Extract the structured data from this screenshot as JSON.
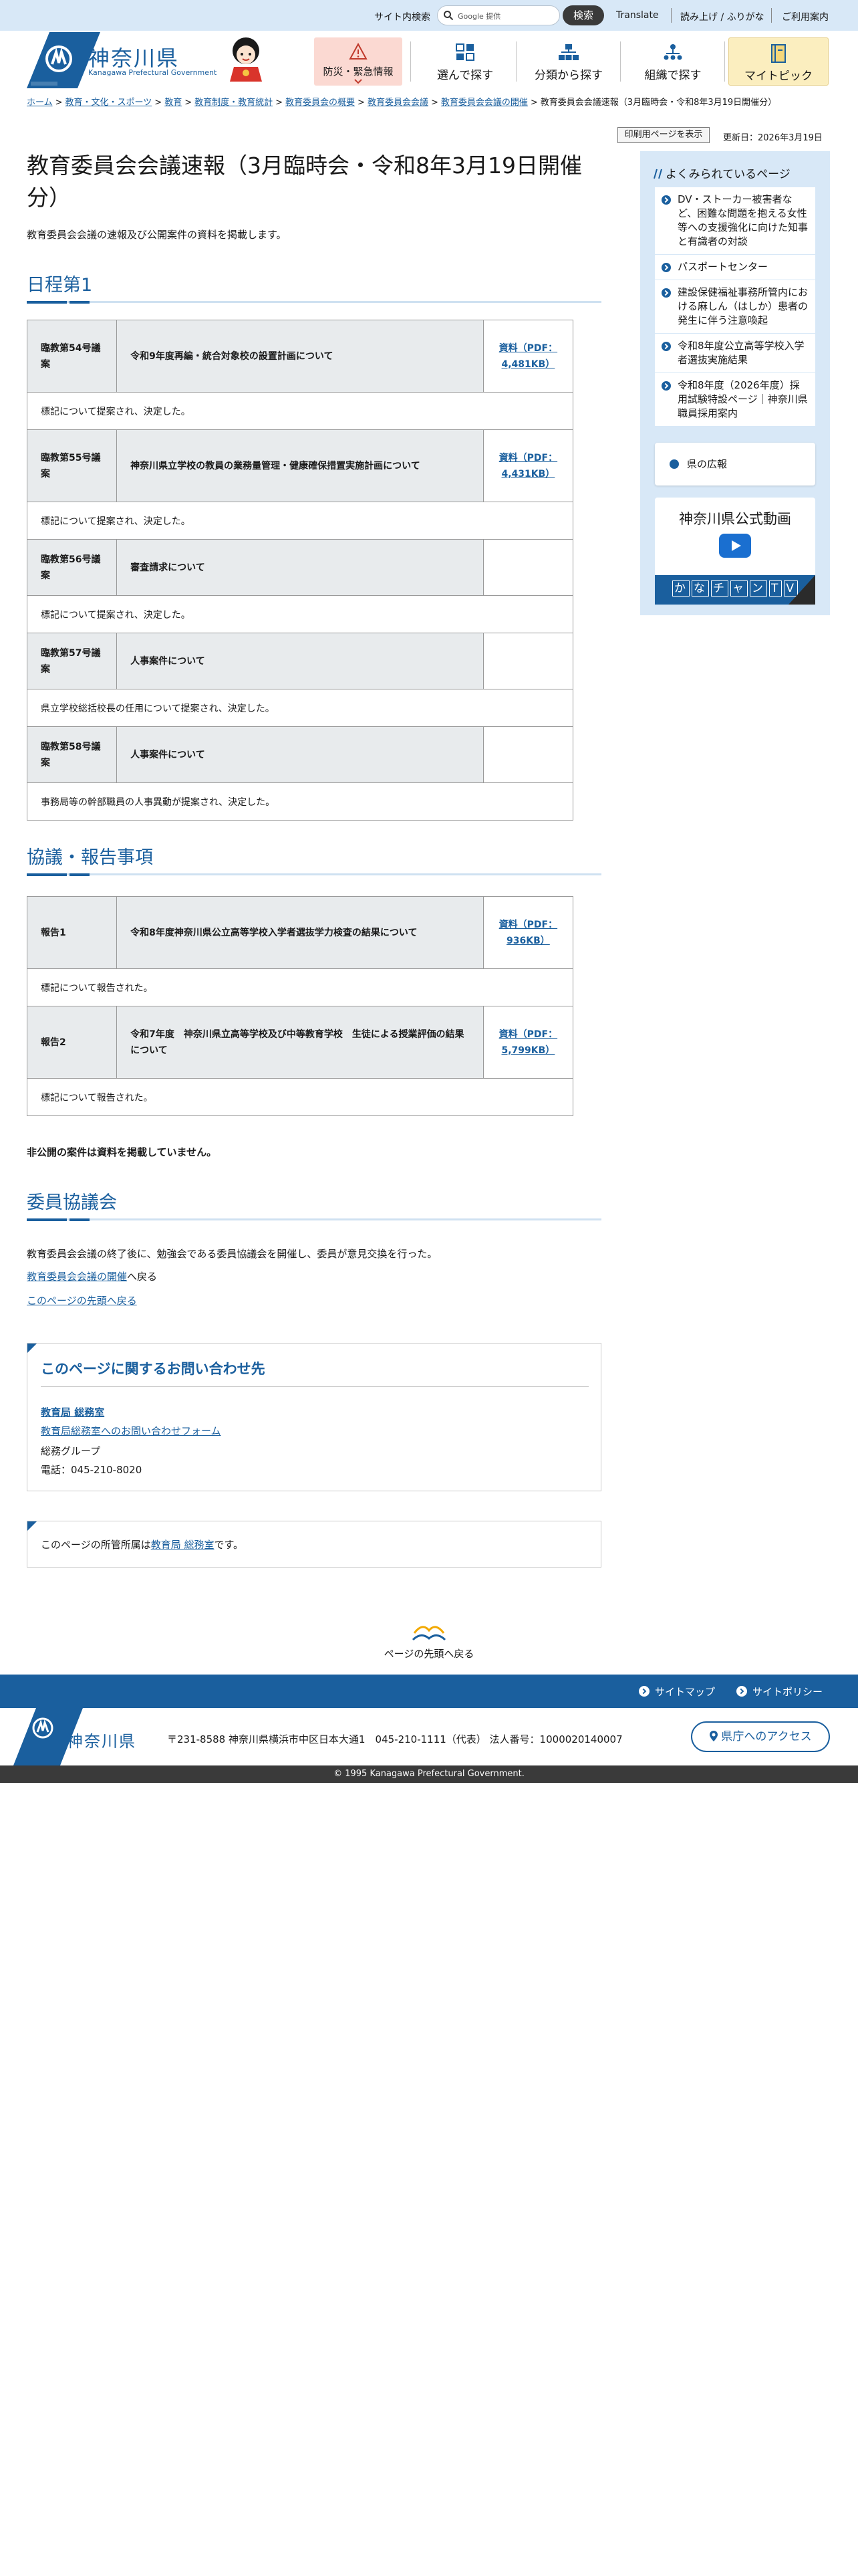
{
  "utility": {
    "search_label": "サイト内検索",
    "search_placeholder": "Google 提供",
    "search_button": "検索",
    "translate": "Translate",
    "furigana": "読み上げ / ふりがな",
    "guide": "ご利用案内"
  },
  "header": {
    "logo_jp": "神奈川県",
    "logo_en": "Kanagawa Prefectural Government",
    "nav": [
      {
        "label": "防災・緊急情報",
        "icon": "warning-icon"
      },
      {
        "label": "選んで探す",
        "icon": "grid-icon"
      },
      {
        "label": "分類から探す",
        "icon": "category-tree-icon"
      },
      {
        "label": "組織で探す",
        "icon": "org-chart-icon"
      },
      {
        "label": "マイトピック",
        "icon": "notebook-icon"
      }
    ]
  },
  "breadcrumb": {
    "items": [
      "ホーム",
      "教育・文化・スポーツ",
      "教育",
      "教育制度・教育統計",
      "教育委員会の概要",
      "教育委員会会議",
      "教育委員会会議の開催"
    ],
    "current": "教育委員会会議速報（3月臨時会・令和8年3月19日開催分）"
  },
  "print_button": "印刷用ページを表示",
  "updated": "更新日：2026年3月19日",
  "main": {
    "title": "教育委員会会議速報（3月臨時会・令和8年3月19日開催分）",
    "lead": "教育委員会会議の速報及び公開案件の資料を掲載します。",
    "section1": {
      "heading": "日程第1",
      "rows": [
        {
          "no": "臨教第54号議案",
          "title": "令和9年度再編・統合対象校の設置計画について",
          "doc": "資料（PDF：4,481KB）",
          "result": "標記について提案され、決定した。"
        },
        {
          "no": "臨教第55号議案",
          "title": "神奈川県立学校の教員の業務量管理・健康確保措置実施計画について",
          "doc": "資料（PDF：4,431KB）",
          "result": "標記について提案され、決定した。"
        },
        {
          "no": "臨教第56号議案",
          "title": "審査請求について",
          "doc": "",
          "result": "標記について提案され、決定した。"
        },
        {
          "no": "臨教第57号議案",
          "title": "人事案件について",
          "doc": "",
          "result": "県立学校総括校長の任用について提案され、決定した。"
        },
        {
          "no": "臨教第58号議案",
          "title": "人事案件について",
          "doc": "",
          "result": "事務局等の幹部職員の人事異動が提案され、決定した。"
        }
      ]
    },
    "section2": {
      "heading": "協議・報告事項",
      "rows": [
        {
          "no": "報告1",
          "title": "令和8年度神奈川県公立高等学校入学者選抜学力検査の結果について",
          "doc": "資料（PDF：936KB）",
          "result": "標記について報告された。"
        },
        {
          "no": "報告2",
          "title": "令和7年度　神奈川県立高等学校及び中等教育学校　生徒による授業評価の結果について",
          "doc": "資料（PDF：5,799KB）",
          "result": "標記について報告された。"
        }
      ]
    },
    "note": "非公開の案件は資料を掲載していません。",
    "section3": {
      "heading": "委員協議会",
      "text": "教育委員会会議の終了後に、勉強会である委員協議会を開催し、委員が意見交換を行った。",
      "back_link": "教育委員会会議の開催",
      "back_suffix": "へ戻る",
      "top_link": "このページの先頭へ戻る"
    },
    "contact": {
      "title": "このページに関するお問い合わせ先",
      "dept": "教育局 総務室",
      "form": "教育局総務室へのお問い合わせフォーム",
      "group": "総務グループ",
      "tel": "電話：045-210-8020"
    },
    "owner": {
      "prefix": "このページの所管所属は",
      "dept": "教育局 総務室",
      "suffix": "です。"
    },
    "to_top": "ページの先頭へ戻る"
  },
  "sidebar": {
    "heading": "よくみられているページ",
    "items": [
      "DV・ストーカー被害者など、困難な問題を抱える女性等への支援強化に向けた知事と有識者の対談",
      "パスポートセンター",
      "建設保健福祉事務所管内における麻しん（はしか）患者の発生に伴う注意喚起",
      "令和8年度公立高等学校入学者選抜実施結果",
      "令和8年度（2026年度）採用試験特設ページ｜神奈川県職員採用案内"
    ],
    "kouhou": "県の広報",
    "video_title": "神奈川県公式動画",
    "video_band": [
      "か",
      "な",
      "チ",
      "ャ",
      "ン",
      "T",
      "V"
    ]
  },
  "footer": {
    "sitemap": "サイトマップ",
    "policy": "サイトポリシー",
    "name": "神奈川県",
    "address": "〒231-8588 神奈川県横浜市中区日本大通1　045-210-1111（代表） 法人番号：1000020140007",
    "access": "県庁へのアクセス",
    "copyright": "© 1995 Kanagawa Prefectural Government."
  },
  "colors": {
    "brand": "#1a5f9e",
    "utility_bg": "#d8e8f7",
    "emergency_bg": "#fbd9d2",
    "mytopic_bg": "#fbeebf"
  }
}
